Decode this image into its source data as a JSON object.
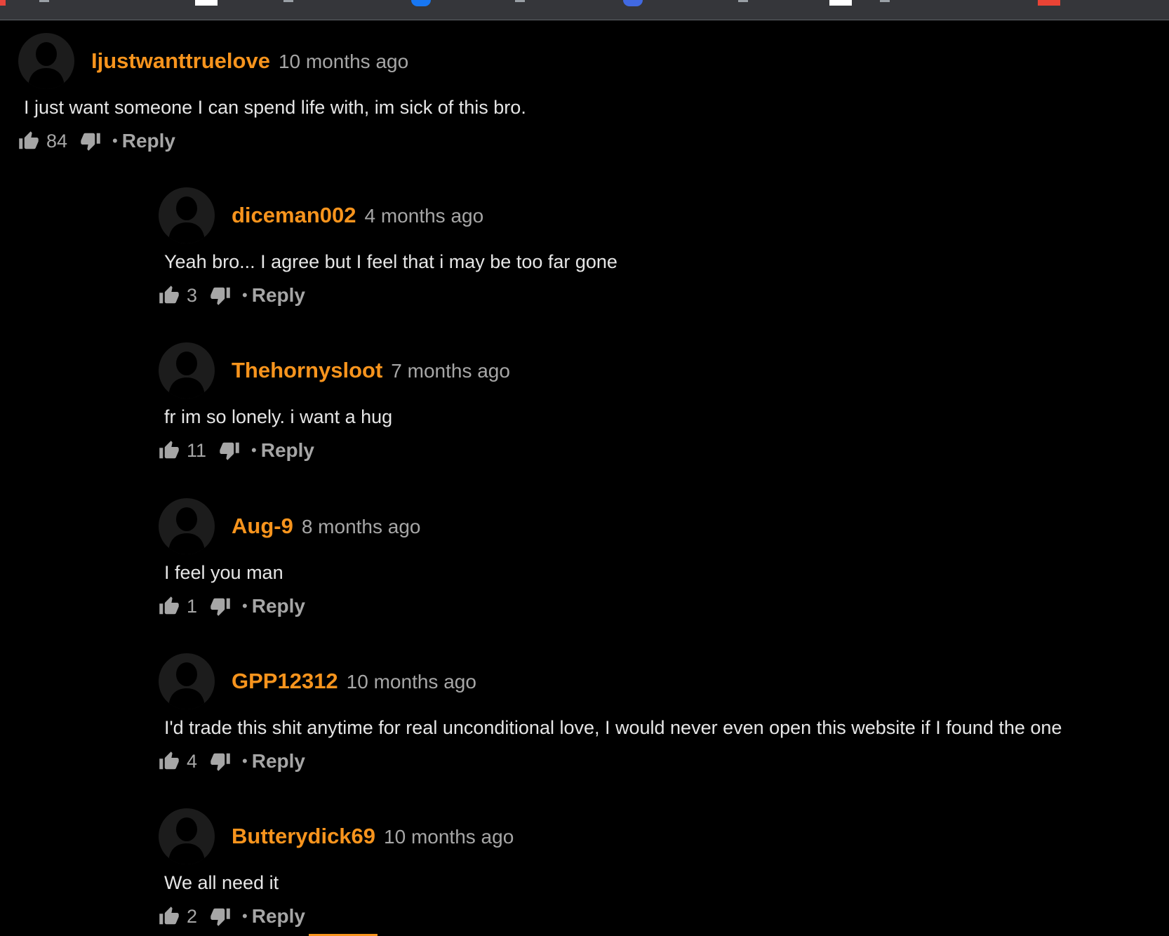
{
  "colors": {
    "background": "#000000",
    "username": "#f7941d",
    "meta": "#a6a6a6",
    "body_text": "#e6e6e6",
    "avatar_bg": "#1c1c1c",
    "avatar_silhouette": "#000000"
  },
  "comments": [
    {
      "username": "Ijustwanttruelove",
      "time": "10 months ago",
      "text": "I just want someone I can spend life with, im sick of this bro.",
      "likes": "84",
      "reply_label": "Reply",
      "separator": "•"
    },
    {
      "username": "diceman002",
      "time": "4 months ago",
      "text": "Yeah bro... I agree but I feel that i may be too far gone",
      "likes": "3",
      "reply_label": "Reply",
      "separator": "•"
    },
    {
      "username": "Thehornysloot",
      "time": "7 months ago",
      "text": "fr im so lonely. i want a hug",
      "likes": "11",
      "reply_label": "Reply",
      "separator": "•"
    },
    {
      "username": "Aug-9",
      "time": "8 months ago",
      "text": "I feel you man",
      "likes": "1",
      "reply_label": "Reply",
      "separator": "•"
    },
    {
      "username": "GPP12312",
      "time": "10 months ago",
      "text": "I'd trade this shit anytime for real unconditional love, I would never even open this website if I found the one",
      "likes": "4",
      "reply_label": "Reply",
      "separator": "•"
    },
    {
      "username": "Butterydick69",
      "time": "10 months ago",
      "text": "We all need it",
      "likes": "2",
      "reply_label": "Reply",
      "separator": "•"
    }
  ]
}
